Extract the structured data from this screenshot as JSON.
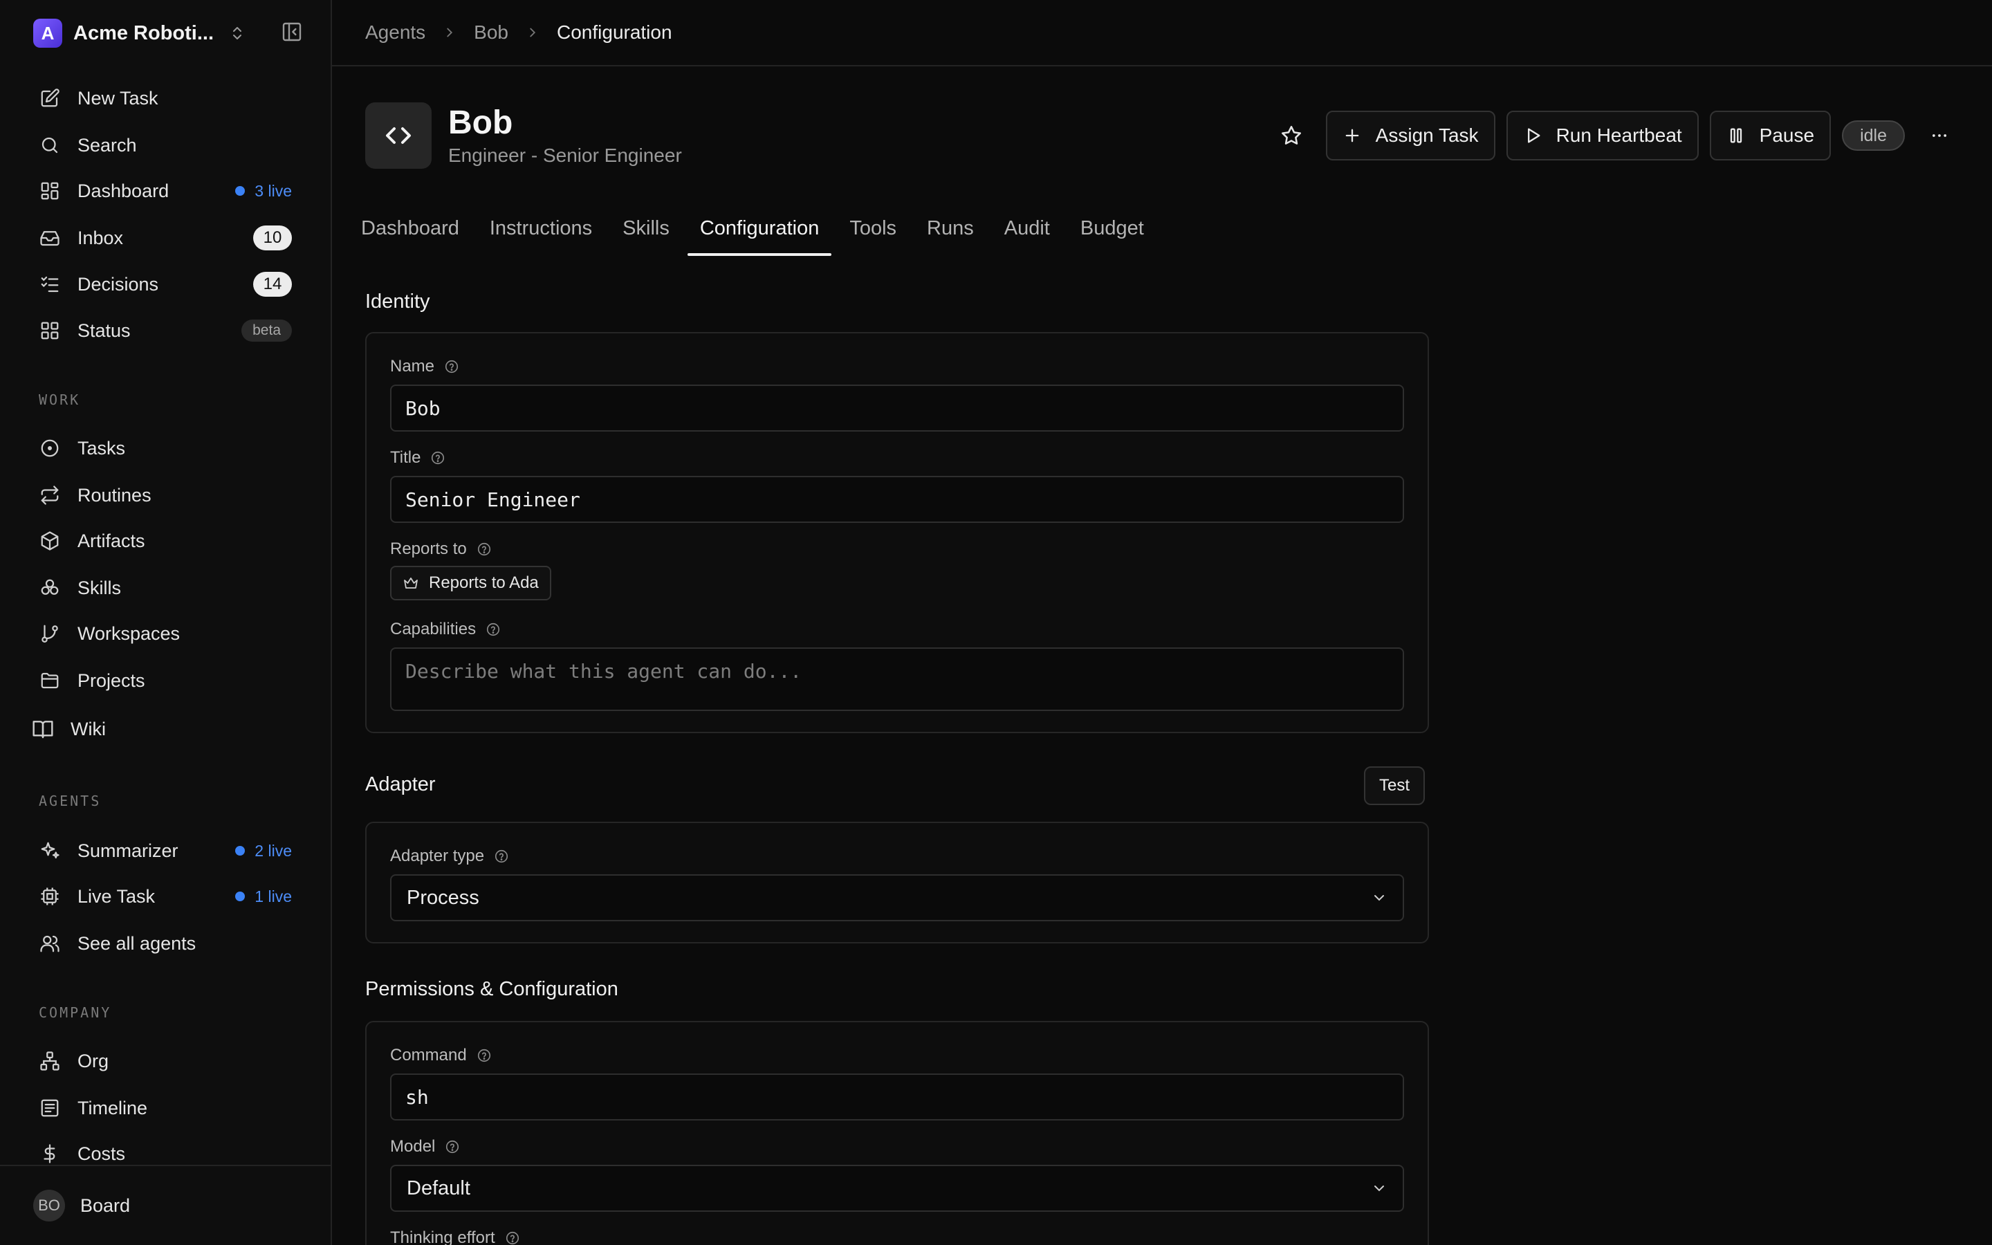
{
  "sidebar": {
    "org_name": "Acme Roboti...",
    "org_initial": "A",
    "primary_items": [
      {
        "label": "New Task",
        "icon": "edit-icon"
      },
      {
        "label": "Search",
        "icon": "search-icon"
      },
      {
        "label": "Dashboard",
        "icon": "grid-icon",
        "live": "3 live"
      },
      {
        "label": "Inbox",
        "icon": "inbox-icon",
        "count": "10"
      },
      {
        "label": "Decisions",
        "icon": "checklist-icon",
        "count": "14"
      },
      {
        "label": "Status",
        "icon": "grid-icon",
        "badge": "beta"
      }
    ],
    "work_label": "WORK",
    "work_items": [
      {
        "label": "Tasks",
        "icon": "circle-dot-icon"
      },
      {
        "label": "Routines",
        "icon": "repeat-icon"
      },
      {
        "label": "Artifacts",
        "icon": "package-icon"
      },
      {
        "label": "Skills",
        "icon": "cluster-icon"
      },
      {
        "label": "Workspaces",
        "icon": "git-branch-icon"
      },
      {
        "label": "Projects",
        "icon": "folder-icon"
      },
      {
        "label": "Wiki",
        "icon": "book-icon"
      }
    ],
    "agents_label": "AGENTS",
    "agent_items": [
      {
        "label": "Summarizer",
        "icon": "sparkles-icon",
        "live": "2 live"
      },
      {
        "label": "Live Task",
        "icon": "cpu-icon",
        "live": "1 live"
      },
      {
        "label": "See all agents",
        "icon": "users-icon"
      }
    ],
    "company_label": "COMPANY",
    "company_items": [
      {
        "label": "Org",
        "icon": "org-chart-icon"
      },
      {
        "label": "Timeline",
        "icon": "timeline-icon"
      },
      {
        "label": "Costs",
        "icon": "dollar-icon"
      }
    ],
    "footer": {
      "avatar": "BO",
      "label": "Board"
    }
  },
  "breadcrumb": {
    "items": [
      "Agents",
      "Bob",
      "Configuration"
    ]
  },
  "agent": {
    "name": "Bob",
    "subtitle": "Engineer - Senior Engineer",
    "status": "idle",
    "actions": {
      "assign": "Assign Task",
      "heartbeat": "Run Heartbeat",
      "pause": "Pause"
    }
  },
  "tabs": [
    "Dashboard",
    "Instructions",
    "Skills",
    "Configuration",
    "Tools",
    "Runs",
    "Audit",
    "Budget"
  ],
  "active_tab": "Configuration",
  "identity": {
    "title": "Identity",
    "name_label": "Name",
    "name_value": "Bob",
    "title_label": "Title",
    "title_value": "Senior Engineer",
    "reports_label": "Reports to",
    "reports_value": "Reports to Ada",
    "capabilities_label": "Capabilities",
    "capabilities_placeholder": "Describe what this agent can do..."
  },
  "adapter": {
    "title": "Adapter",
    "test_label": "Test",
    "type_label": "Adapter type",
    "type_value": "Process"
  },
  "permissions": {
    "title": "Permissions & Configuration",
    "command_label": "Command",
    "command_value": "sh",
    "model_label": "Model",
    "model_value": "Default",
    "thinking_label": "Thinking effort"
  },
  "colors": {
    "accent_live": "#3b82f6",
    "background": "#0b0b0b",
    "logo": "#5b3ef0"
  }
}
